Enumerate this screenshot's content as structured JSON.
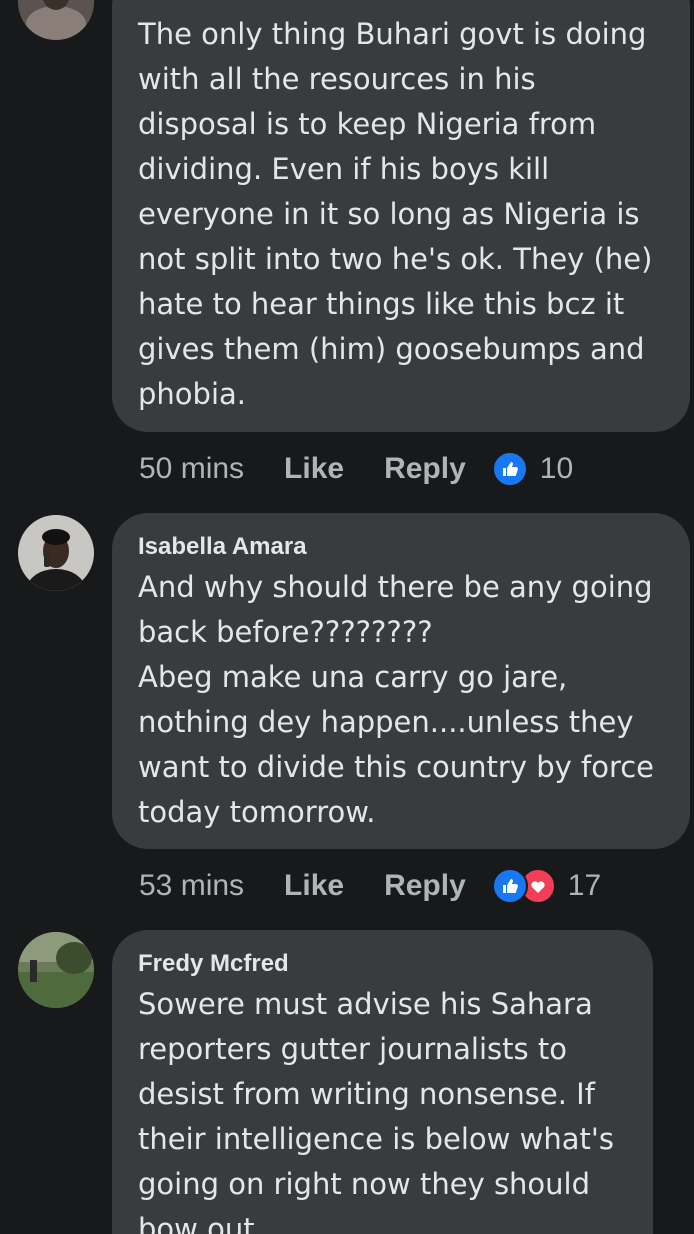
{
  "comments": [
    {
      "author": "",
      "text": "The only thing Buhari govt is doing\nwith all the resources in his\ndisposal is to keep Nigeria from\ndividing. Even if his boys kill\neveryone in it so long as Nigeria is\nnot split into two he's ok. They (he)\nhate to hear things like this bcz it\ngives them (him) goosebumps and\nphobia.",
      "time": "50 mins",
      "like_label": "Like",
      "reply_label": "Reply",
      "reactions": [
        "like-reaction-icon"
      ],
      "reaction_count": "10"
    },
    {
      "author": "Isabella Amara",
      "text": "And why should there be any going\nback before????????\nAbeg make una carry go jare,\nnothing dey happen....unless they\nwant to divide this country by force\ntoday tomorrow.",
      "time": "53 mins",
      "like_label": "Like",
      "reply_label": "Reply",
      "reactions": [
        "like-reaction-icon",
        "love-reaction-icon"
      ],
      "reaction_count": "17"
    },
    {
      "author": "Fredy Mcfred",
      "text": "Sowere must advise his Sahara\nreporters gutter journalists to\ndesist from writing nonsense. If\ntheir intelligence is below what's\ngoing on right now they should\nbow out."
    }
  ],
  "colors": {
    "background": "#18191a",
    "bubble": "#3a3b3c",
    "primary_text": "#e4e6eb",
    "secondary_text": "#b0b3b8",
    "like_blue": "#1877f2",
    "love_red": "#f33e58"
  }
}
